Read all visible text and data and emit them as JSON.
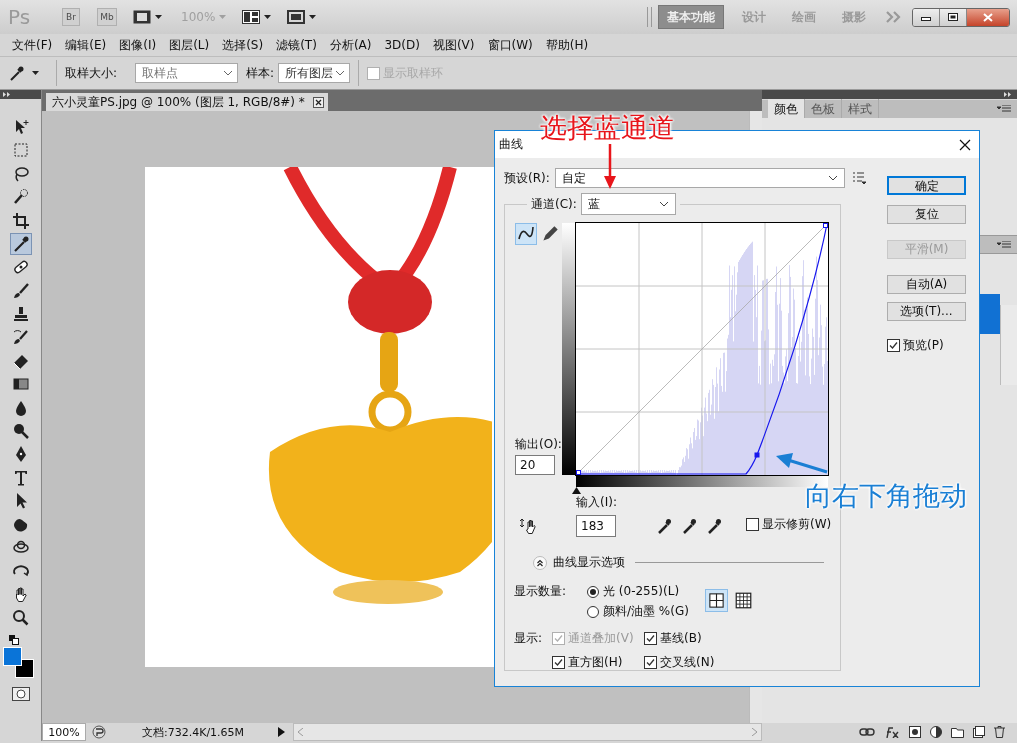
{
  "app": {
    "logo": "Ps",
    "bridge_button": "Br",
    "mini_bridge_button": "Mb",
    "zoom_level": "100%"
  },
  "workspaces": [
    {
      "label": "基本功能",
      "selected": true
    },
    {
      "label": "设计",
      "selected": false
    },
    {
      "label": "绘画",
      "selected": false
    },
    {
      "label": "摄影",
      "selected": false
    }
  ],
  "menu": [
    "文件(F)",
    "编辑(E)",
    "图像(I)",
    "图层(L)",
    "选择(S)",
    "滤镜(T)",
    "分析(A)",
    "3D(D)",
    "视图(V)",
    "窗口(W)",
    "帮助(H)"
  ],
  "options_bar": {
    "sample_size_label": "取样大小:",
    "sample_size": "取样点",
    "sample_label": "样本:",
    "sample": "所有图层",
    "show_ring": {
      "label": "显示取样环",
      "checked": false,
      "disabled": true
    }
  },
  "tools": [
    {
      "kind": "move",
      "selected": false
    },
    {
      "kind": "marquee",
      "selected": false
    },
    {
      "kind": "lasso",
      "selected": false
    },
    {
      "kind": "quick-select",
      "selected": false
    },
    {
      "kind": "crop",
      "selected": false
    },
    {
      "kind": "eyedropper",
      "selected": true
    },
    {
      "kind": "heal",
      "selected": false
    },
    {
      "kind": "brush",
      "selected": false
    },
    {
      "kind": "stamp",
      "selected": false
    },
    {
      "kind": "history-brush",
      "selected": false
    },
    {
      "kind": "eraser",
      "selected": false
    },
    {
      "kind": "gradient",
      "selected": false
    },
    {
      "kind": "blur",
      "selected": false
    },
    {
      "kind": "dodge",
      "selected": false
    },
    {
      "kind": "pen",
      "selected": false
    },
    {
      "kind": "type",
      "selected": false
    },
    {
      "kind": "path-select",
      "selected": false
    },
    {
      "kind": "shape",
      "selected": false
    },
    {
      "kind": "rotate-3d",
      "selected": false
    },
    {
      "kind": "orbit-3d",
      "selected": false
    },
    {
      "kind": "hand",
      "selected": false
    },
    {
      "kind": "zoom",
      "selected": false
    }
  ],
  "document_tab": {
    "title": "六小灵童PS.jpg @ 100% (图层 1, RGB/8#) *"
  },
  "panel_tabs": [
    {
      "label": "颜色",
      "selected": true
    },
    {
      "label": "色板",
      "selected": false
    },
    {
      "label": "样式",
      "selected": false
    }
  ],
  "status_bar": {
    "zoom": "100%",
    "doc_info": "文档:732.4K/1.65M"
  },
  "dialog": {
    "title": "曲线",
    "preset_label": "预设(R):",
    "preset": "自定",
    "channel_label": "通道(C):",
    "channel": "蓝",
    "curve_tools": [
      {
        "kind": "curve",
        "selected": true
      },
      {
        "kind": "pencil",
        "selected": false
      }
    ],
    "output_label": "输出(O):",
    "output": "20",
    "input_label": "输入(I):",
    "input": "183",
    "show_clipping": {
      "label": "显示修剪(W)",
      "checked": false
    },
    "buttons": [
      {
        "label": "确定",
        "default": true,
        "disabled": false
      },
      {
        "label": "复位",
        "default": false,
        "disabled": false
      },
      {
        "label": "平滑(M)",
        "default": false,
        "disabled": true
      },
      {
        "label": "自动(A)",
        "default": false,
        "disabled": false
      },
      {
        "label": "选项(T)...",
        "default": false,
        "disabled": false
      }
    ],
    "preview": {
      "label": "预览(P)",
      "checked": true
    },
    "options_title": "曲线显示选项",
    "amount_label": "显示数量:",
    "amount_options": [
      {
        "label": "光 (0-255)(L)",
        "selected": true
      },
      {
        "label": "颜料/油墨 %(G)",
        "selected": false
      }
    ],
    "grid_options": [
      {
        "kind": "simple",
        "selected": true
      },
      {
        "kind": "detailed",
        "selected": false
      }
    ],
    "show_label": "显示:",
    "show_options": [
      {
        "label": "通道叠加(V)",
        "checked": true,
        "disabled": true
      },
      {
        "label": "基线(B)",
        "checked": true,
        "disabled": false
      },
      {
        "label": "直方图(H)",
        "checked": true,
        "disabled": false
      },
      {
        "label": "交叉线(N)",
        "checked": true,
        "disabled": false
      }
    ]
  },
  "annotations": [
    {
      "text": "选择蓝通道",
      "color": "#e8151b"
    },
    {
      "text": "向右下角拖动",
      "color": "#1a7fd4"
    }
  ]
}
